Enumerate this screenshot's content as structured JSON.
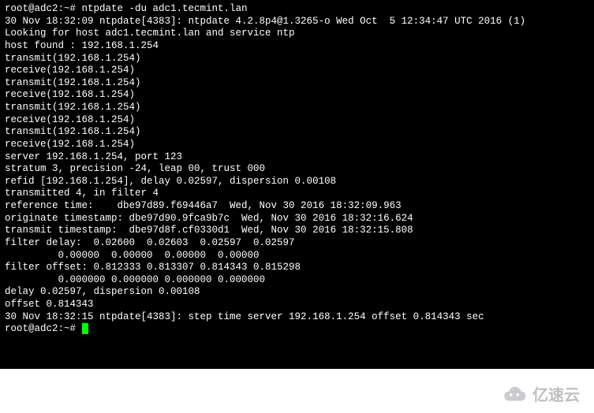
{
  "prompt1": "root@adc2:~# ",
  "command": "ntpdate -du adc1.tecmint.lan",
  "lines": [
    "30 Nov 18:32:09 ntpdate[4383]: ntpdate 4.2.8p4@1.3265-o Wed Oct  5 12:34:47 UTC 2016 (1)",
    "Looking for host adc1.tecmint.lan and service ntp",
    "host found : 192.168.1.254",
    "transmit(192.168.1.254)",
    "receive(192.168.1.254)",
    "transmit(192.168.1.254)",
    "receive(192.168.1.254)",
    "transmit(192.168.1.254)",
    "receive(192.168.1.254)",
    "transmit(192.168.1.254)",
    "receive(192.168.1.254)",
    "server 192.168.1.254, port 123",
    "stratum 3, precision -24, leap 00, trust 000",
    "refid [192.168.1.254], delay 0.02597, dispersion 0.00108",
    "transmitted 4, in filter 4",
    "reference time:    dbe97d89.f69446a7  Wed, Nov 30 2016 18:32:09.963",
    "originate timestamp: dbe97d90.9fca9b7c  Wed, Nov 30 2016 18:32:16.624",
    "transmit timestamp:  dbe97d8f.cf0330d1  Wed, Nov 30 2016 18:32:15.808",
    "filter delay:  0.02600  0.02603  0.02597  0.02597",
    "         0.00000  0.00000  0.00000  0.00000",
    "filter offset: 0.812333 0.813307 0.814343 0.815298",
    "         0.000000 0.000000 0.000000 0.000000",
    "delay 0.02597, dispersion 0.00108",
    "offset 0.814343",
    "",
    "30 Nov 18:32:15 ntpdate[4383]: step time server 192.168.1.254 offset 0.814343 sec"
  ],
  "prompt2": "root@adc2:~# ",
  "watermark": "亿速云"
}
